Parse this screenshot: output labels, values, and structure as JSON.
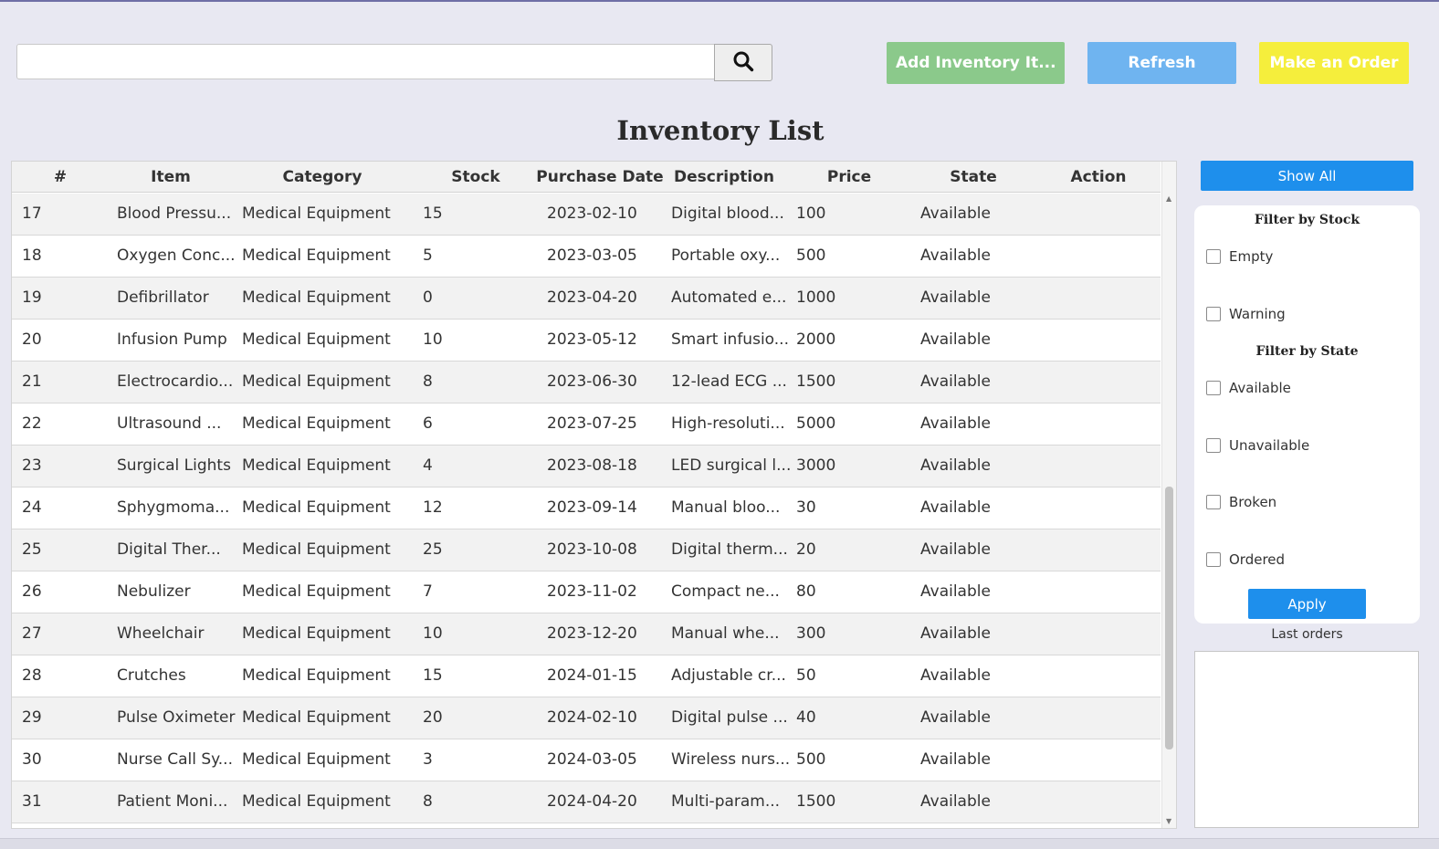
{
  "search": {
    "placeholder": "",
    "value": ""
  },
  "toolbar": {
    "add_label": "Add Inventory It...",
    "refresh_label": "Refresh",
    "order_label": "Make an Order"
  },
  "page_title": "Inventory List",
  "table": {
    "columns": [
      "#",
      "Item",
      "Category",
      "Stock",
      "Purchase Date",
      "Description",
      "Price",
      "State",
      "Action"
    ],
    "rows": [
      [
        "17",
        "Blood Pressu...",
        "Medical Equipment",
        "15",
        "2023-02-10",
        "Digital blood...",
        "100",
        "Available",
        ""
      ],
      [
        "18",
        "Oxygen Conc...",
        "Medical Equipment",
        "5",
        "2023-03-05",
        "Portable oxy...",
        "500",
        "Available",
        ""
      ],
      [
        "19",
        "Defibrillator",
        "Medical Equipment",
        "0",
        "2023-04-20",
        "Automated e...",
        "1000",
        "Available",
        ""
      ],
      [
        "20",
        "Infusion Pump",
        "Medical Equipment",
        "10",
        "2023-05-12",
        "Smart infusio...",
        "2000",
        "Available",
        ""
      ],
      [
        "21",
        "Electrocardio...",
        "Medical Equipment",
        "8",
        "2023-06-30",
        "12-lead ECG ...",
        "1500",
        "Available",
        ""
      ],
      [
        "22",
        "Ultrasound ...",
        "Medical Equipment",
        "6",
        "2023-07-25",
        "High-resoluti...",
        "5000",
        "Available",
        ""
      ],
      [
        "23",
        "Surgical Lights",
        "Medical Equipment",
        "4",
        "2023-08-18",
        "LED surgical l...",
        "3000",
        "Available",
        ""
      ],
      [
        "24",
        "Sphygmoma...",
        "Medical Equipment",
        "12",
        "2023-09-14",
        "Manual bloo...",
        "30",
        "Available",
        ""
      ],
      [
        "25",
        "Digital Ther...",
        "Medical Equipment",
        "25",
        "2023-10-08",
        "Digital therm...",
        "20",
        "Available",
        ""
      ],
      [
        "26",
        "Nebulizer",
        "Medical Equipment",
        "7",
        "2023-11-02",
        "Compact ne...",
        "80",
        "Available",
        ""
      ],
      [
        "27",
        "Wheelchair",
        "Medical Equipment",
        "10",
        "2023-12-20",
        "Manual whe...",
        "300",
        "Available",
        ""
      ],
      [
        "28",
        "Crutches",
        "Medical Equipment",
        "15",
        "2024-01-15",
        "Adjustable cr...",
        "50",
        "Available",
        ""
      ],
      [
        "29",
        "Pulse Oximeter",
        "Medical Equipment",
        "20",
        "2024-02-10",
        "Digital pulse ...",
        "40",
        "Available",
        ""
      ],
      [
        "30",
        "Nurse Call Sy...",
        "Medical Equipment",
        "3",
        "2024-03-05",
        "Wireless nurs...",
        "500",
        "Available",
        ""
      ],
      [
        "31",
        "Patient Moni...",
        "Medical Equipment",
        "8",
        "2024-04-20",
        "Multi-param...",
        "1500",
        "Available",
        ""
      ]
    ]
  },
  "sidebar": {
    "show_all_label": "Show All",
    "stock_heading": "Filter by Stock",
    "stock_options": [
      "Empty",
      "Warning"
    ],
    "state_heading": "Filter by State",
    "state_options": [
      "Available",
      "Unavailable",
      "Broken",
      "Ordered"
    ],
    "apply_label": "Apply",
    "last_orders_label": "Last orders"
  },
  "colors": {
    "background": "#e8e8f2",
    "add_button": "#8bc98b",
    "refresh_button": "#6fb4f0",
    "order_button": "#f5ee3c",
    "primary_button": "#1e8fec"
  },
  "icons": {
    "search": "search-icon"
  }
}
